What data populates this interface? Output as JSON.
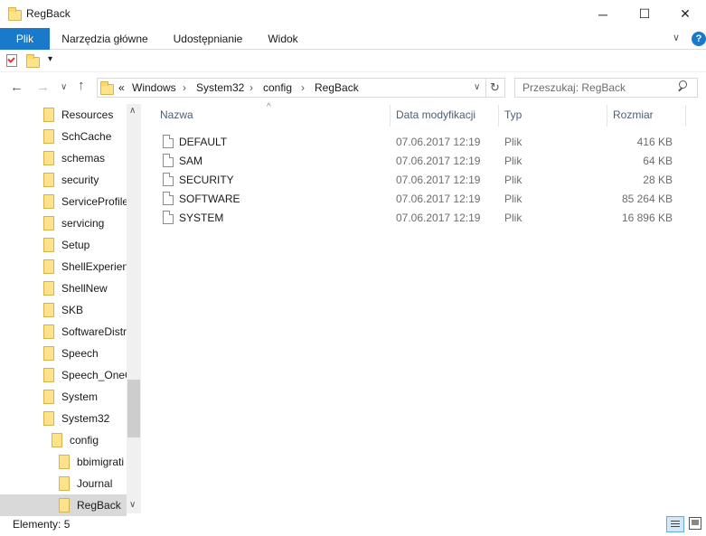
{
  "window": {
    "title": "RegBack",
    "minimize": "─",
    "maximize": "☐",
    "close": "✕"
  },
  "ribbon": {
    "tabs": [
      "Plik",
      "Narzędzia główne",
      "Udostępnianie",
      "Widok"
    ]
  },
  "address": {
    "overflow": "«",
    "crumbs": [
      "Windows",
      "System32",
      "config",
      "RegBack"
    ]
  },
  "search": {
    "placeholder": "Przeszukaj: RegBack"
  },
  "sidebar": {
    "items": [
      {
        "label": "Resources",
        "level": 0
      },
      {
        "label": "SchCache",
        "level": 0
      },
      {
        "label": "schemas",
        "level": 0
      },
      {
        "label": "security",
        "level": 0
      },
      {
        "label": "ServiceProfile",
        "level": 0
      },
      {
        "label": "servicing",
        "level": 0
      },
      {
        "label": "Setup",
        "level": 0
      },
      {
        "label": "ShellExperien",
        "level": 0
      },
      {
        "label": "ShellNew",
        "level": 0
      },
      {
        "label": "SKB",
        "level": 0
      },
      {
        "label": "SoftwareDistr",
        "level": 0
      },
      {
        "label": "Speech",
        "level": 0
      },
      {
        "label": "Speech_OneC",
        "level": 0
      },
      {
        "label": "System",
        "level": 0
      },
      {
        "label": "System32",
        "level": 0
      },
      {
        "label": "config",
        "level": 1
      },
      {
        "label": "bbimigrati",
        "level": 2
      },
      {
        "label": "Journal",
        "level": 2
      },
      {
        "label": "RegBack",
        "level": 2,
        "selected": true
      }
    ]
  },
  "columns": {
    "name": "Nazwa",
    "date": "Data modyfikacji",
    "type": "Typ",
    "size": "Rozmiar"
  },
  "files": [
    {
      "name": "DEFAULT",
      "date": "07.06.2017 12:19",
      "type": "Plik",
      "size": "416 KB"
    },
    {
      "name": "SAM",
      "date": "07.06.2017 12:19",
      "type": "Plik",
      "size": "64 KB"
    },
    {
      "name": "SECURITY",
      "date": "07.06.2017 12:19",
      "type": "Plik",
      "size": "28 KB"
    },
    {
      "name": "SOFTWARE",
      "date": "07.06.2017 12:19",
      "type": "Plik",
      "size": "85 264 KB"
    },
    {
      "name": "SYSTEM",
      "date": "07.06.2017 12:19",
      "type": "Plik",
      "size": "16 896 KB"
    }
  ],
  "status": {
    "count": "Elementy: 5"
  },
  "colors": {
    "accent": "#1979ca",
    "selected": "#d9d9d9",
    "folder": "#ffe38a"
  }
}
